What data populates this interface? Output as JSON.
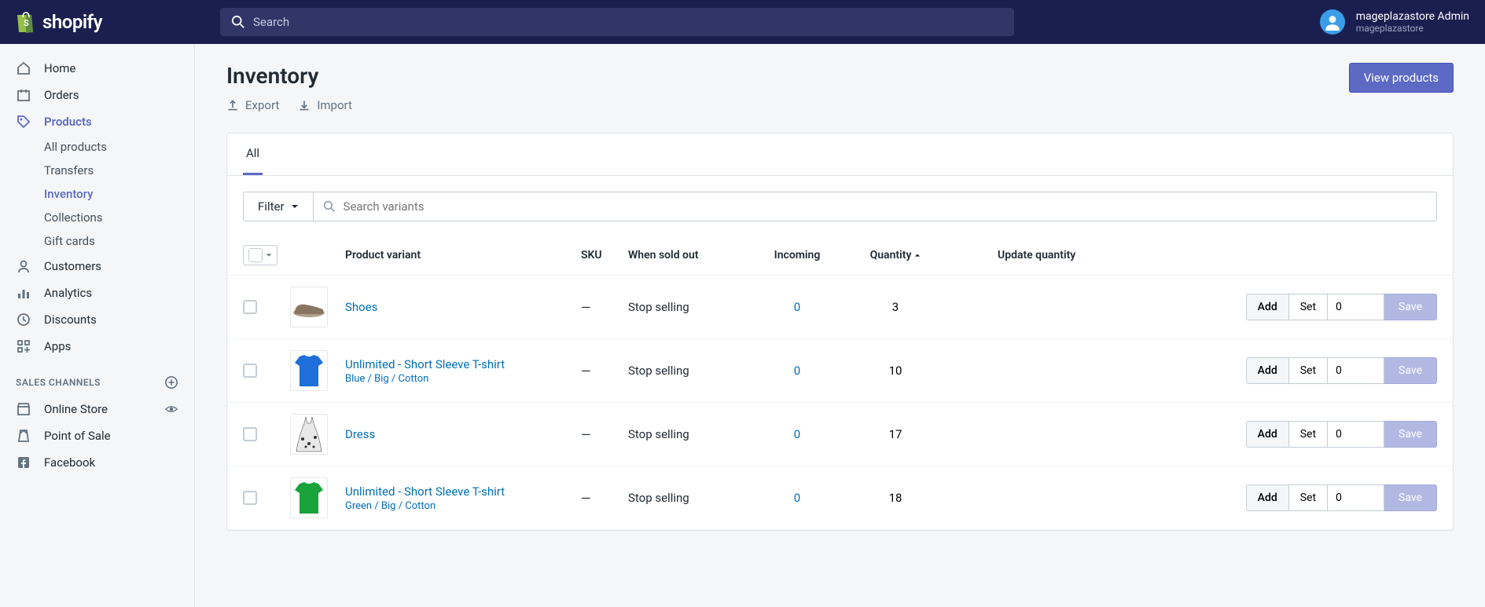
{
  "header": {
    "logo_text": "shopify",
    "search_placeholder": "Search",
    "user_name": "mageplazastore Admin",
    "user_store": "mageplazastore"
  },
  "sidebar": {
    "items": {
      "home": "Home",
      "orders": "Orders",
      "products": "Products",
      "customers": "Customers",
      "analytics": "Analytics",
      "discounts": "Discounts",
      "apps": "Apps"
    },
    "products_sub": {
      "all": "All products",
      "transfers": "Transfers",
      "inventory": "Inventory",
      "collections": "Collections",
      "gift": "Gift cards"
    },
    "channels_header": "SALES CHANNELS",
    "channels": {
      "online": "Online Store",
      "pos": "Point of Sale",
      "facebook": "Facebook"
    }
  },
  "page": {
    "title": "Inventory",
    "export": "Export",
    "import": "Import",
    "view_products": "View products",
    "tab_all": "All",
    "filter_label": "Filter",
    "search_placeholder": "Search variants",
    "columns": {
      "variant": "Product variant",
      "sku": "SKU",
      "sold_out": "When sold out",
      "incoming": "Incoming",
      "quantity": "Quantity",
      "update": "Update quantity"
    },
    "add": "Add",
    "set": "Set",
    "save": "Save"
  },
  "rows": [
    {
      "name": "Shoes",
      "variant": "",
      "sku": "—",
      "sold_out": "Stop selling",
      "incoming": "0",
      "qty": "3",
      "input": "0",
      "thumb": "shoe"
    },
    {
      "name": "Unlimited - Short Sleeve T-shirt",
      "variant": "Blue / Big / Cotton",
      "sku": "—",
      "sold_out": "Stop selling",
      "incoming": "0",
      "qty": "10",
      "input": "0",
      "thumb": "tshirt-blue"
    },
    {
      "name": "Dress",
      "variant": "",
      "sku": "—",
      "sold_out": "Stop selling",
      "incoming": "0",
      "qty": "17",
      "input": "0",
      "thumb": "dress"
    },
    {
      "name": "Unlimited - Short Sleeve T-shirt",
      "variant": "Green / Big / Cotton",
      "sku": "—",
      "sold_out": "Stop selling",
      "incoming": "0",
      "qty": "18",
      "input": "0",
      "thumb": "tshirt-green"
    }
  ]
}
